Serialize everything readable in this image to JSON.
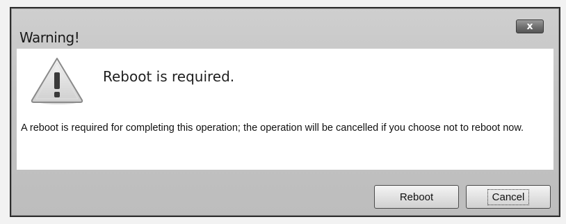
{
  "dialog": {
    "title": "Warning!",
    "close_label": "x",
    "icon": "warning-triangle-icon",
    "heading": "Reboot is required.",
    "message": "A reboot is required for completing this operation; the operation will be cancelled if you choose not to reboot now.",
    "buttons": {
      "reboot": "Reboot",
      "cancel": "Cancel"
    }
  }
}
